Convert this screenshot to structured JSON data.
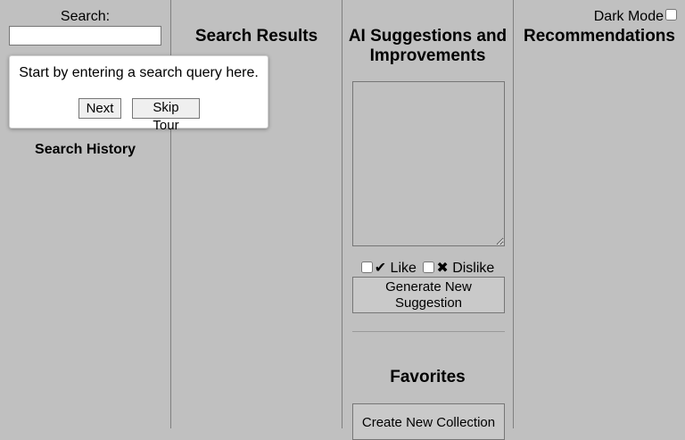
{
  "search": {
    "label": "Search:",
    "value": "",
    "placeholder": ""
  },
  "search_history": {
    "heading": "Search History"
  },
  "search_results": {
    "heading": "Search Results"
  },
  "ai_panel": {
    "heading": "AI Suggestions and Improvements",
    "suggestion_text": "",
    "like_label": "✔ Like",
    "dislike_label": "✖ Dislike",
    "generate_button": "Generate New Suggestion"
  },
  "favorites": {
    "heading": "Favorites",
    "create_collection_button": "Create New Collection"
  },
  "recommendations": {
    "heading": "Recommendations",
    "dark_mode_label": "Dark Mode"
  },
  "tour": {
    "message": "Start by entering a search query here.",
    "next_button": "Next",
    "skip_button": "Skip Tour"
  },
  "colors": {
    "background": "#c0c0c0",
    "panel_border": "#808080",
    "tour_background": "#ffffff"
  }
}
